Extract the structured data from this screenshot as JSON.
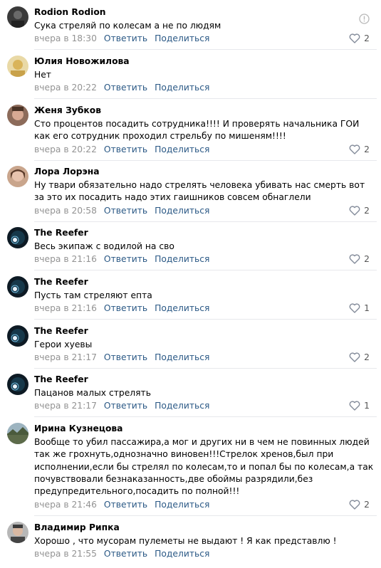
{
  "comments": [
    {
      "author": "Rodion Rodion",
      "text": "Сука стреляй по колесам а не по людям",
      "date": "вчера в 18:30",
      "reply": "Ответить",
      "share": "Поделиться",
      "likes": "2",
      "avatar": "dark-photo",
      "has_info_icon": true
    },
    {
      "author": "Юлия Новожилова",
      "text": "Нет",
      "date": "вчера в 20:22",
      "reply": "Ответить",
      "share": "Поделиться",
      "likes": "",
      "avatar": "yellow-photo"
    },
    {
      "author": "Женя Зубков",
      "text": "Сто процентов посадить сотрудника!!!! И проверять начальника ГОИ как его сотрудник проходил стрельбу по мишеням!!!!",
      "date": "вчера в 20:22",
      "reply": "Ответить",
      "share": "Поделиться",
      "likes": "2",
      "avatar": "face-photo"
    },
    {
      "author": "Лора Лорэна",
      "text": "Ну твари обязательно надо стрелять человека убивать нас смерть вот за это их посадить надо этих гаишников совсем обнаглели",
      "date": "вчера в 20:58",
      "reply": "Ответить",
      "share": "Поделиться",
      "likes": "2",
      "avatar": "woman-photo"
    },
    {
      "author": "The Reefer",
      "text": "Весь экипаж с водилой на сво",
      "date": "вчера в 21:16",
      "reply": "Ответить",
      "share": "Поделиться",
      "likes": "2",
      "avatar": "reefer"
    },
    {
      "author": "The Reefer",
      "text": "Пусть там стреляют епта",
      "date": "вчера в 21:16",
      "reply": "Ответить",
      "share": "Поделиться",
      "likes": "1",
      "avatar": "reefer"
    },
    {
      "author": "The Reefer",
      "text": "Герои хуевы",
      "date": "вчера в 21:17",
      "reply": "Ответить",
      "share": "Поделиться",
      "likes": "2",
      "avatar": "reefer"
    },
    {
      "author": "The Reefer",
      "text": "Пацанов малых стрелять",
      "date": "вчера в 21:17",
      "reply": "Ответить",
      "share": "Поделиться",
      "likes": "1",
      "avatar": "reefer"
    },
    {
      "author": "Ирина Кузнецова",
      "text": "Вообще то убил пассажира,а мог и других ни в чем не повинных людей так же грохнуть,однозначно виновен!!!Стрелок хренов,был при исполнении,если бы стрелял по колесам,то и попал бы по колесам,а так почувствовали безнаказанность,две обоймы разрядили,без предупредительного,посадить по полной!!!",
      "date": "вчера в 21:46",
      "reply": "Ответить",
      "share": "Поделиться",
      "likes": "2",
      "avatar": "landscape-photo"
    },
    {
      "author": "Владимир Рипка",
      "text": "Хорошо , что мусорам пулеметы не выдают ! Я как представлю !",
      "date": "вчера в 21:55",
      "reply": "Ответить",
      "share": "Поделиться",
      "likes": "",
      "avatar": "man-photo"
    }
  ]
}
